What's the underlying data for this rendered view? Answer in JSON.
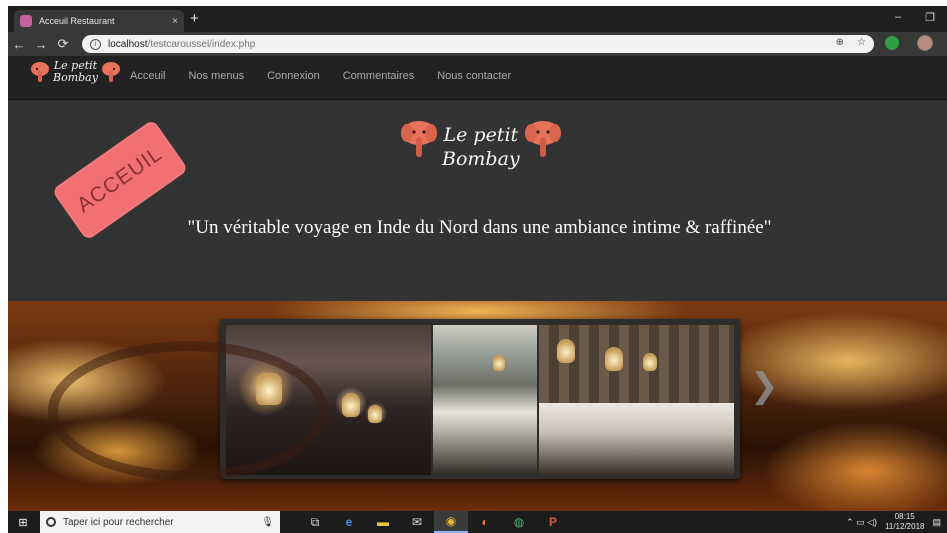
{
  "browser": {
    "tab_title": "Acceuil Restaurant",
    "tab_close": "×",
    "new_tab": "+",
    "url_host": "localhost",
    "url_path": "/testcaroussel/index.php",
    "nav_back": "←",
    "nav_forward": "→",
    "nav_reload": "⟳",
    "info_glyph": "i",
    "window_minimize": "–",
    "window_restore": "❐",
    "tool_zoom": "⊕",
    "tool_star": "☆",
    "tool_menu": "⋮"
  },
  "site": {
    "logo_line1": "Le petit",
    "logo_line2": "Bombay",
    "nav_items": [
      "Acceuil",
      "Nos menus",
      "Connexion",
      "Commentaires",
      "Nous contacter"
    ],
    "stamp": "ACCEUIL",
    "tagline": "\"Un véritable voyage en Inde du Nord dans une ambiance intime & raffinée\"",
    "carousel_next": "❯"
  },
  "taskbar": {
    "start_icon": "⊞",
    "search_placeholder": "Taper ici pour rechercher",
    "mic_glyph": "🎙",
    "apps": [
      "task-view",
      "edge",
      "file-explorer",
      "mail",
      "chrome",
      "firefox",
      "green-app",
      "powerpoint"
    ],
    "app_glyphs": [
      "⧉",
      "e",
      "▬",
      "✉",
      "◉",
      "◐",
      "◍",
      "P"
    ],
    "time": "08:15",
    "date": "11/12/2018",
    "tray_glyphs": "⌃ ▭ ◁)",
    "notification_glyph": "▤"
  },
  "colors": {
    "accent_stamp": "#f26f72",
    "nav_bg": "#222222",
    "hero_bg": "#333333"
  }
}
